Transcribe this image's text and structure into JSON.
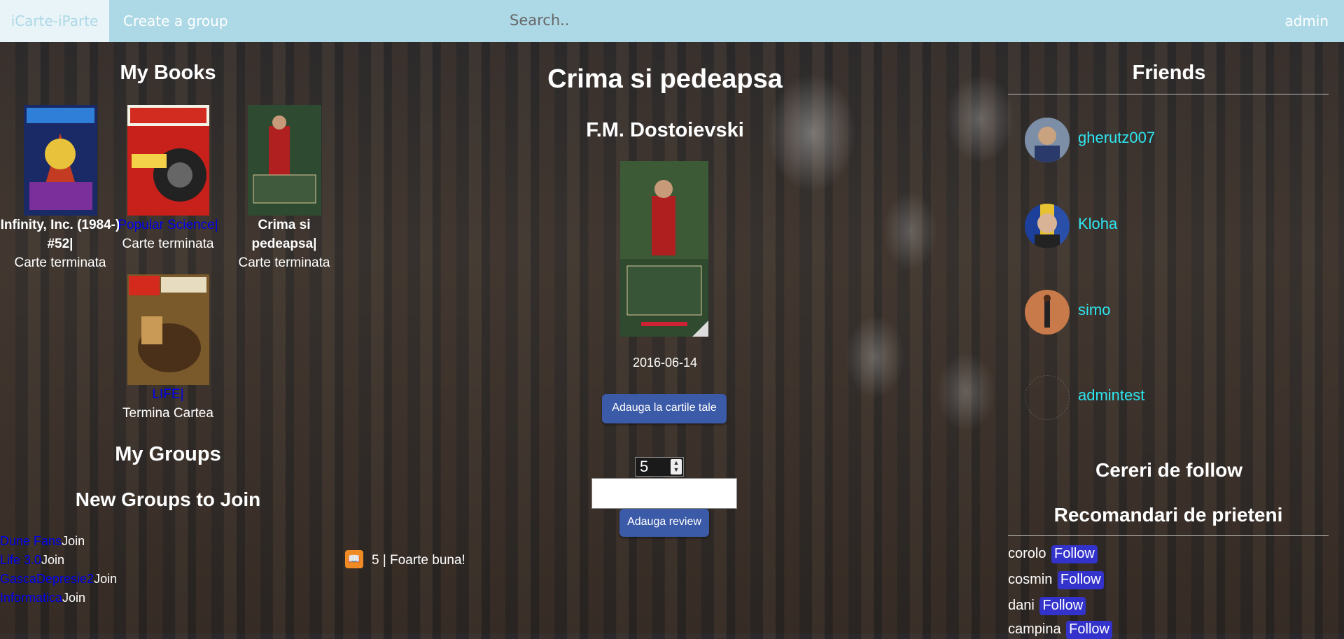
{
  "nav": {
    "brand": "iCarte-iParte",
    "create_group": "Create a group",
    "search_placeholder": "Search..",
    "user": "admin"
  },
  "my_books": {
    "heading": "My Books",
    "items": [
      {
        "title": "Infinity, Inc. (1984-) #52|",
        "status": "Carte terminata"
      },
      {
        "title": "Popular Science|",
        "status": "Carte terminata"
      },
      {
        "title": "Crima si pedeapsa|",
        "status": "Carte terminata"
      },
      {
        "title": "LIFE|",
        "status": "Termina Cartea"
      }
    ]
  },
  "groups": {
    "my_heading": "My Groups",
    "new_heading": "New Groups to Join",
    "join_label": "Join",
    "items": [
      "Dune Fans",
      "Life 3.0",
      "GascaDepresie2",
      "Informatica"
    ]
  },
  "book": {
    "title": "Crima si pedeapsa",
    "author": "F.M. Dostoievski",
    "date": "2016-06-14",
    "add_button": "Adauga la cartile tale",
    "rating_value": "5",
    "review_button": "Adauga review",
    "review": {
      "text": "5 | Foarte buna!"
    }
  },
  "friends": {
    "heading": "Friends",
    "items": [
      "gherutz007",
      "Kloha",
      "simo",
      "admintest"
    ]
  },
  "follow_requests": {
    "heading": "Cereri de follow"
  },
  "recommendations": {
    "heading": "Recomandari de prieteni",
    "follow_label": "Follow",
    "items": [
      "corolo",
      "cosmin",
      "dani",
      "campina"
    ]
  },
  "colors": {
    "navbar": "#add8e6",
    "link_cyan": "#2ee6f0",
    "button": "#3b5aa8",
    "follow": "#3333cc"
  }
}
